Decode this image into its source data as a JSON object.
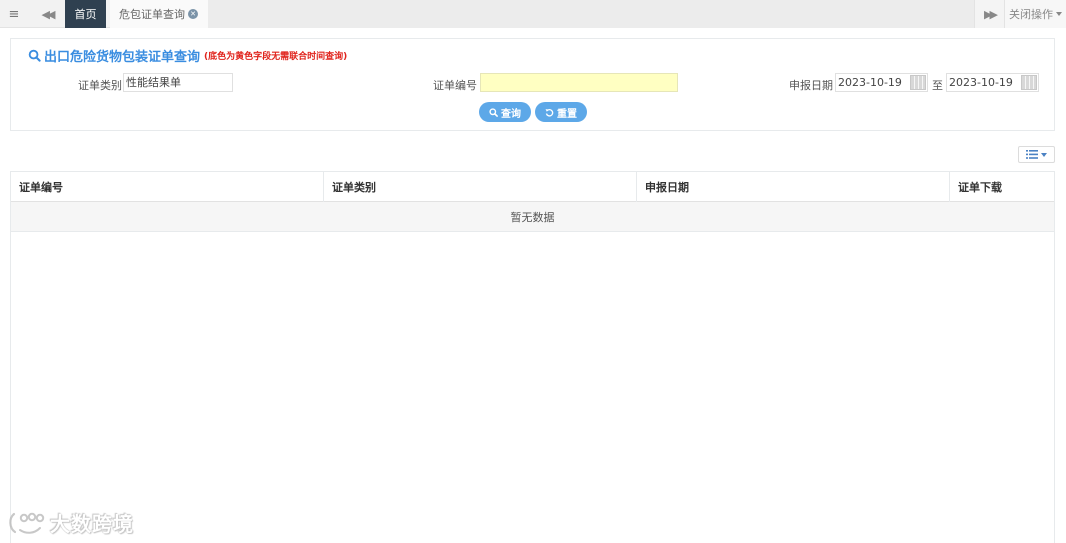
{
  "tabbar": {
    "home_tab": "首页",
    "current_tab": "危包证单查询",
    "close_ops": "关闭操作"
  },
  "panel": {
    "title": "出口危险货物包装证单查询",
    "note": "(底色为黄色字段无需联合时间查询)"
  },
  "form": {
    "cert_type_label": "证单类别",
    "cert_type_value": "性能结果单",
    "cert_no_label": "证单编号",
    "cert_no_value": "",
    "date_label": "申报日期",
    "date_from": "2023-10-19",
    "date_sep": "至",
    "date_to": "2023-10-19",
    "search_btn": "查询",
    "reset_btn": "重置"
  },
  "table": {
    "columns": [
      "证单编号",
      "证单类别",
      "申报日期",
      "证单下载"
    ],
    "empty_text": "暂无数据"
  },
  "watermark": {
    "text": "大数跨境"
  },
  "colors": {
    "accent": "#3a8de0",
    "button": "#5da8e8",
    "note": "#e0231c",
    "yellow_field": "#ffffc2",
    "home_tab": "#2f4050"
  }
}
